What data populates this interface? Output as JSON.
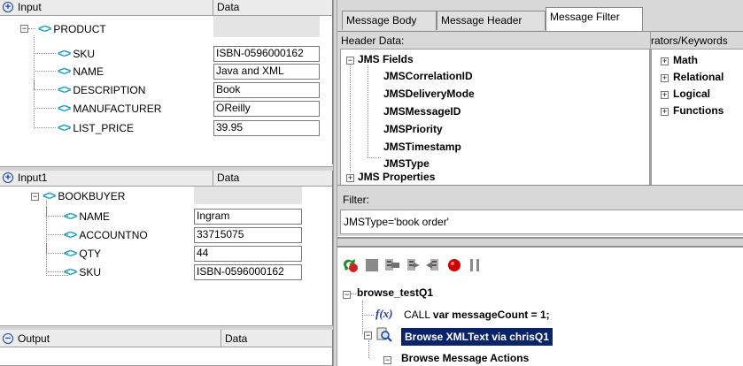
{
  "input_panel": {
    "header": {
      "col1": "Input",
      "col2": "Data"
    },
    "root": "PRODUCT",
    "rows": [
      {
        "label": "SKU",
        "value": "ISBN-0596000162"
      },
      {
        "label": "NAME",
        "value": "Java and XML"
      },
      {
        "label": "DESCRIPTION",
        "value": "Book"
      },
      {
        "label": "MANUFACTURER",
        "value": "OReilly"
      },
      {
        "label": "LIST_PRICE",
        "value": "39.95"
      }
    ]
  },
  "input1_panel": {
    "header": {
      "col1": "Input1",
      "col2": "Data"
    },
    "root": "BOOKBUYER",
    "rows": [
      {
        "label": "NAME",
        "value": "Ingram"
      },
      {
        "label": "ACCOUNTNO",
        "value": "33715075"
      },
      {
        "label": "QTY",
        "value": "44"
      },
      {
        "label": "SKU",
        "value": "ISBN-0596000162"
      }
    ]
  },
  "output_panel": {
    "header": {
      "col1": "Output",
      "col2": "Data"
    }
  },
  "tabs": [
    {
      "label": "Message Body"
    },
    {
      "label": "Message Header"
    },
    {
      "label": "Message Filter"
    }
  ],
  "header_data": {
    "title": "Header Data:",
    "group1": "JMS Fields",
    "fields": [
      "JMSCorrelationID",
      "JMSDeliveryMode",
      "JMSMessageID",
      "JMSPriority",
      "JMSTimestamp",
      "JMSType"
    ],
    "group2": "JMS Properties"
  },
  "operators": {
    "title": "rators/Keywords",
    "items": [
      "Math",
      "Relational",
      "Logical",
      "Functions"
    ]
  },
  "filter": {
    "label": "Filter:",
    "value": "JMSType='book order'"
  },
  "flow": {
    "root": "browse_testQ1",
    "call_prefix": "CALL",
    "call_text": "var messageCount = 1;",
    "selected": "Browse XMLText via chrisQ1",
    "actions": "Browse Message Actions"
  },
  "colors": {
    "tag": "#2a9fbd",
    "selection": "#0a246a",
    "record": "#cc0000"
  }
}
